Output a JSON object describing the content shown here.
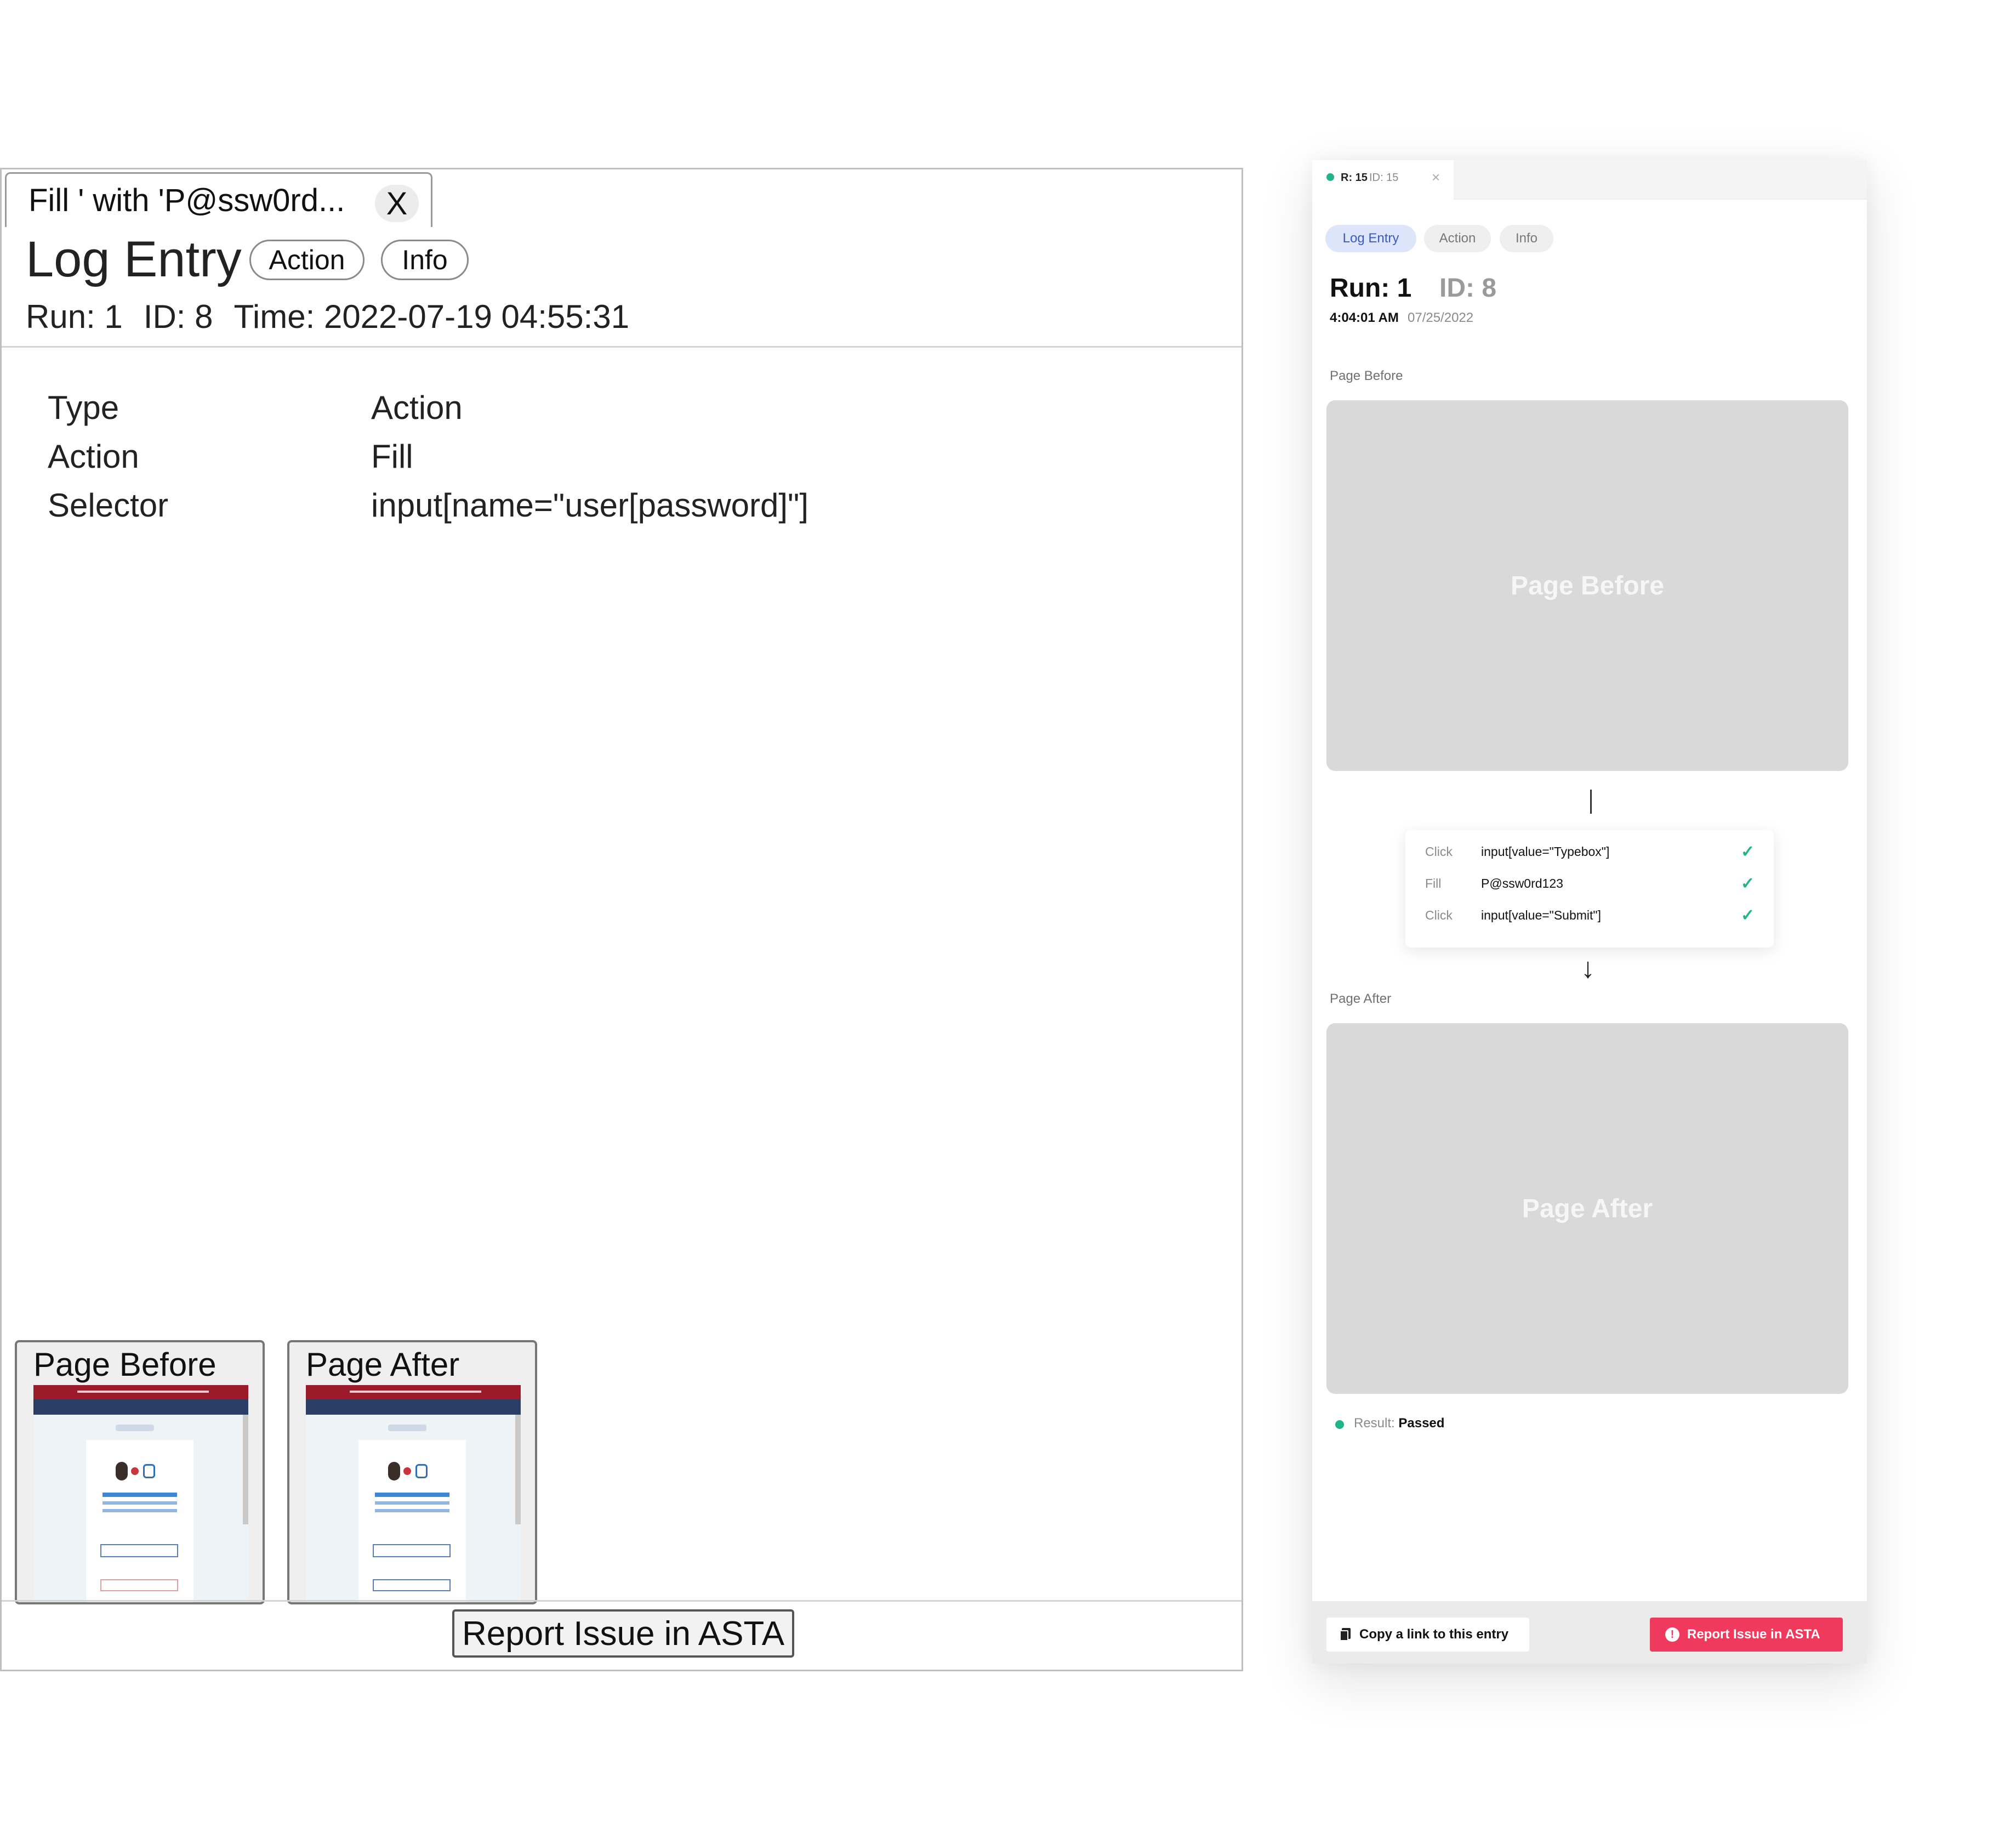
{
  "old_panel": {
    "tab": {
      "label": "Fill ' with 'P@ssw0rd...",
      "close_label": "X"
    },
    "title": "Log Entry",
    "pills": {
      "action": "Action",
      "info": "Info"
    },
    "meta": {
      "run": "Run: 1",
      "id": "ID: 8",
      "time": "Time: 2022-07-19 04:55:31"
    },
    "details": [
      {
        "key": "Type",
        "value": "Action"
      },
      {
        "key": "Action",
        "value": "Fill"
      },
      {
        "key": "Selector",
        "value": "input[name=\"user[password]\"]"
      }
    ],
    "thumbnails": {
      "before": "Page Before",
      "after": "Page After"
    },
    "report_button": "Report Issue in ASTA"
  },
  "new_panel": {
    "tab": {
      "run": "R: 15",
      "id": "ID: 15",
      "close_icon": "close-icon"
    },
    "chips": {
      "log_entry": "Log Entry",
      "action": "Action",
      "info": "Info"
    },
    "run": "Run: 1",
    "id": "ID: 8",
    "time": "4:04:01 AM",
    "date": "07/25/2022",
    "page_before_label": "Page Before",
    "page_before_placeholder": "Page Before",
    "page_after_label": "Page After",
    "page_after_placeholder": "Page After",
    "steps": [
      {
        "action": "Click",
        "value": "input[value=\"Typebox\"]",
        "status": "check-icon"
      },
      {
        "action": "Fill",
        "value": "P@ssw0rd123",
        "status": "check-icon"
      },
      {
        "action": "Click",
        "value": "input[value=\"Submit\"]",
        "status": "check-icon"
      }
    ],
    "result": {
      "label": "Result:",
      "value": "Passed"
    },
    "copy_button": "Copy a link to this entry",
    "report_button": "Report Issue in ASTA",
    "colors": {
      "success": "#1fb48a",
      "accent_chip_bg": "#dce5fa",
      "accent_chip_text": "#3a5bb8",
      "report": "#ef3a5d",
      "placeholder": "#d9d9d9"
    }
  }
}
